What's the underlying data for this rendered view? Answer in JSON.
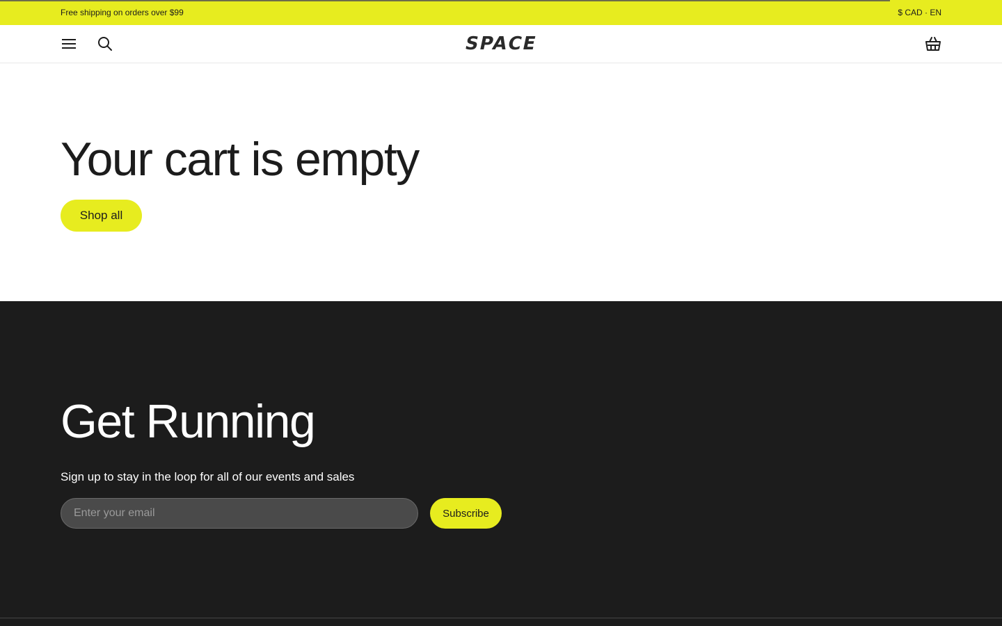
{
  "announcement": {
    "text": "Free shipping on orders over $99",
    "locale": "$ CAD · EN",
    "progress": 0.888
  },
  "header": {
    "logo": "SPACE",
    "icons": {
      "menu": "menu-icon",
      "search": "search-icon",
      "cart": "basket-icon"
    }
  },
  "cart": {
    "title": "Your cart is empty",
    "shop_all_label": "Shop all"
  },
  "newsletter": {
    "title": "Get Running",
    "subtitle": "Sign up to stay in the loop for all of our events and sales",
    "email_placeholder": "Enter your email",
    "email_value": "",
    "subscribe_label": "Subscribe"
  },
  "colors": {
    "accent": "#e7ec1f",
    "dark": "#1c1c1c"
  }
}
